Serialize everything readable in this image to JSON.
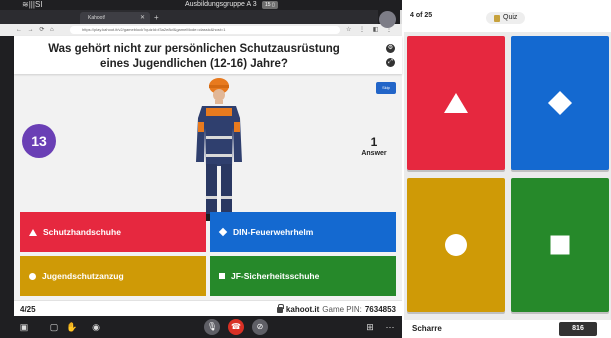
{
  "call": {
    "logo": "≋|||SI",
    "meeting_title": "Ausbildungsgruppe A 3",
    "meeting_badge": "15 ▯",
    "tab_label": "Kahoot!",
    "tab_close": "✕",
    "tab_new": "+",
    "nav_icons": "← → ⟳ ⌂",
    "url": "https://play.kahoot.it/v2/gameblock?quizId=f3a2e8cf&gameMode=classic&host=1",
    "bar_icons": "☆ ⋮ ◧ ⋮"
  },
  "kahoot": {
    "question": "Was gehört nicht zur persönlichen Schutzausrüstung eines Jugendlichen (12-16) Jahre?",
    "skip_label": "Skip",
    "timer": "13",
    "answers_count": "1",
    "answers_label": "Answer",
    "answers": [
      {
        "label": "Schutzhandschuhe",
        "color": "#e6283f",
        "icon": "triangle-icon"
      },
      {
        "label": "DIN-Feuerwehrhelm",
        "color": "#1469d0",
        "icon": "diamond-icon"
      },
      {
        "label": "Jugendschutzanzug",
        "color": "#cf9a06",
        "icon": "circle-icon"
      },
      {
        "label": "JF-Sicherheitsschuhe",
        "color": "#26892a",
        "icon": "square-icon"
      }
    ],
    "progress": "4/25",
    "host": "kahoot.it",
    "game_pin_label": "Game PIN:",
    "game_pin": "7634853"
  },
  "player": {
    "question_of": "4 of 25",
    "mode_label": "Quiz",
    "name": "Scharre",
    "score": "816",
    "tiles": [
      {
        "color": "#e6283f",
        "icon": "triangle-icon"
      },
      {
        "color": "#1469d0",
        "icon": "diamond-icon"
      },
      {
        "color": "#cf9a06",
        "icon": "circle-icon"
      },
      {
        "color": "#26892a",
        "icon": "square-icon"
      }
    ]
  }
}
